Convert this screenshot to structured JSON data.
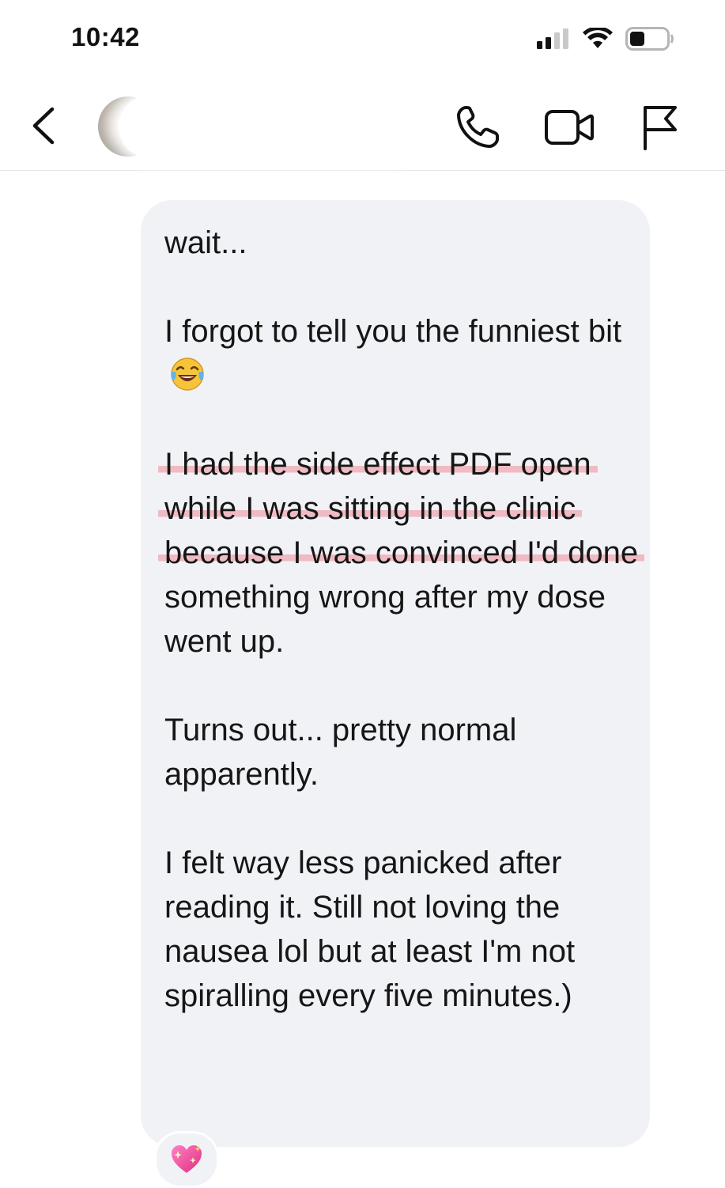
{
  "status_bar": {
    "time": "10:42",
    "icons": [
      "cellular-signal-icon",
      "wifi-icon",
      "battery-icon"
    ]
  },
  "header": {
    "icons": [
      "back-chevron-icon",
      "phone-icon",
      "video-camera-icon",
      "flag-icon"
    ]
  },
  "message": {
    "line_wait": "wait...",
    "para2_text": "I forgot to tell you the funniest bit",
    "para2_emoji": "face-with-tears-of-joy-icon",
    "para3_highlighted": "I had the side effect PDF open while I was sitting in the clinic because I was convinced I'd done",
    "para3_rest": " something wrong after my dose went up.",
    "para4": "Turns out... pretty normal apparently.",
    "para5": "I felt way less panicked after reading it. Still not loving the nausea lol but at least I'm not spiralling every five minutes.)"
  },
  "reaction": {
    "emoji": "sparkling-heart-icon"
  },
  "colors": {
    "bubble_bg": "#f1f2f6",
    "highlight": "#f0a8b0",
    "text": "#161616"
  }
}
